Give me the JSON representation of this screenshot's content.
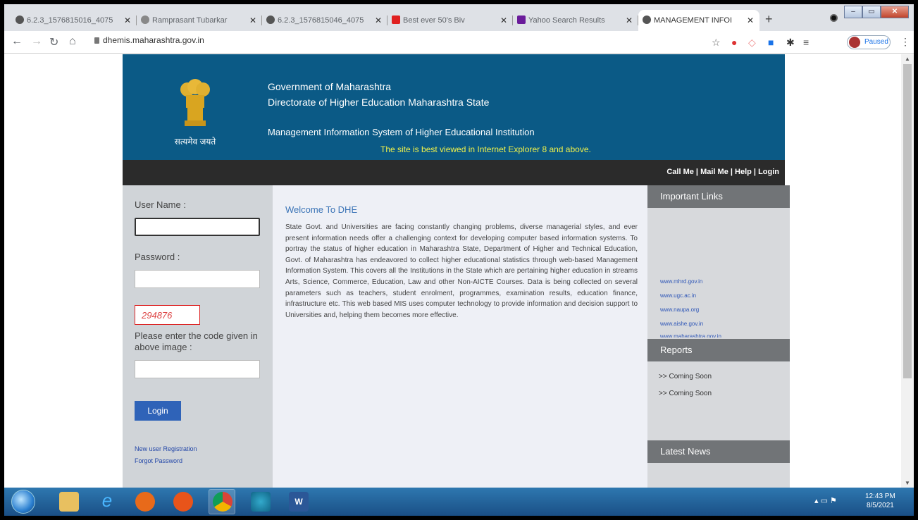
{
  "browser": {
    "tabs": [
      {
        "label": "6.2.3_1576815016_4075",
        "favicon_color": "#555"
      },
      {
        "label": "Ramprasant Tubarkar",
        "favicon_color": "#888"
      },
      {
        "label": "6.2.3_1576815046_4075",
        "favicon_color": "#555"
      },
      {
        "label": "Best ever 50's Biv",
        "favicon_color": "#e02020"
      },
      {
        "label": "Yahoo Search Results",
        "favicon_color": "#6a1b9a"
      },
      {
        "label": "MANAGEMENT INFOI",
        "favicon_color": "#555"
      }
    ],
    "url": "dhemis.maharashtra.gov.in",
    "profile_status": "Paused"
  },
  "header": {
    "motto": "सत्यमेव जयते",
    "title1": "Government of Maharashtra",
    "title2": "Directorate of Higher Education Maharashtra State",
    "title3": "Management Information System of Higher Educational Institution",
    "notice": "The site is best viewed in Internet Explorer 8 and above."
  },
  "toplinks": {
    "call": "Call Me",
    "mail": "Mail Me",
    "help": "Help",
    "login": "Login",
    "separator": " | "
  },
  "login": {
    "username_label": "User Name :",
    "password_label": "Password :",
    "captcha_code": "294876",
    "captcha_prompt": "Please enter the code given in above image :",
    "button": "Login",
    "new_user": "New user Registration",
    "forgot": "Forgot Password"
  },
  "welcome": {
    "title": "Welcome To DHE",
    "body": "State Govt. and Universities are facing constantly changing problems, diverse managerial styles, and ever present information needs offer a challenging context for developing computer based information systems. To portray the status of higher education in Maharashtra State, Department of Higher and Technical Education, Govt. of Maharashtra has endeavored to collect higher educational statistics through web-based Management Information System. This covers all the Institutions in the State which are pertaining higher education in streams Arts, Science, Commerce, Education, Law and other Non-AICTE Courses. Data is being collected on several parameters such as teachers, student enrolment, programmes, examination results, education finance, infrastructure etc. This web based MIS uses computer technology to provide information and decision support to Universities and, helping them becomes more effective."
  },
  "sidebar": {
    "important_links_title": "Important Links",
    "links": [
      "www.mhrd.gov.in",
      "www.ugc.ac.in",
      "www.naupa.org",
      "www.aishe.gov.in",
      "www.maharashtra.gov.in"
    ],
    "reports_title": "Reports",
    "reports": [
      "Coming Soon",
      "Coming Soon"
    ],
    "report_bullet": ">>",
    "news_title": "Latest News"
  },
  "taskbar": {
    "clock_time": "12:43 PM",
    "clock_date": "8/5/2021"
  }
}
